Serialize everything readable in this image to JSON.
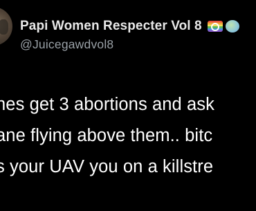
{
  "tweet": {
    "author": {
      "display_name": "Papi Women Respecter Vol 8",
      "handle": "@Juicegawdvol8",
      "avatar_icon": "profile-photo",
      "badge_icons": [
        "rainbow-flag-icon",
        "globe-emoji-icon"
      ]
    },
    "text_lines": [
      "nes get 3 abortions and ask",
      "ane flying above them.. bitc",
      "s your UAV you on a killstre"
    ]
  },
  "colors": {
    "background": "#000000",
    "name": "#e8e8e8",
    "handle": "#9aa1a7",
    "body": "#ffffff"
  }
}
